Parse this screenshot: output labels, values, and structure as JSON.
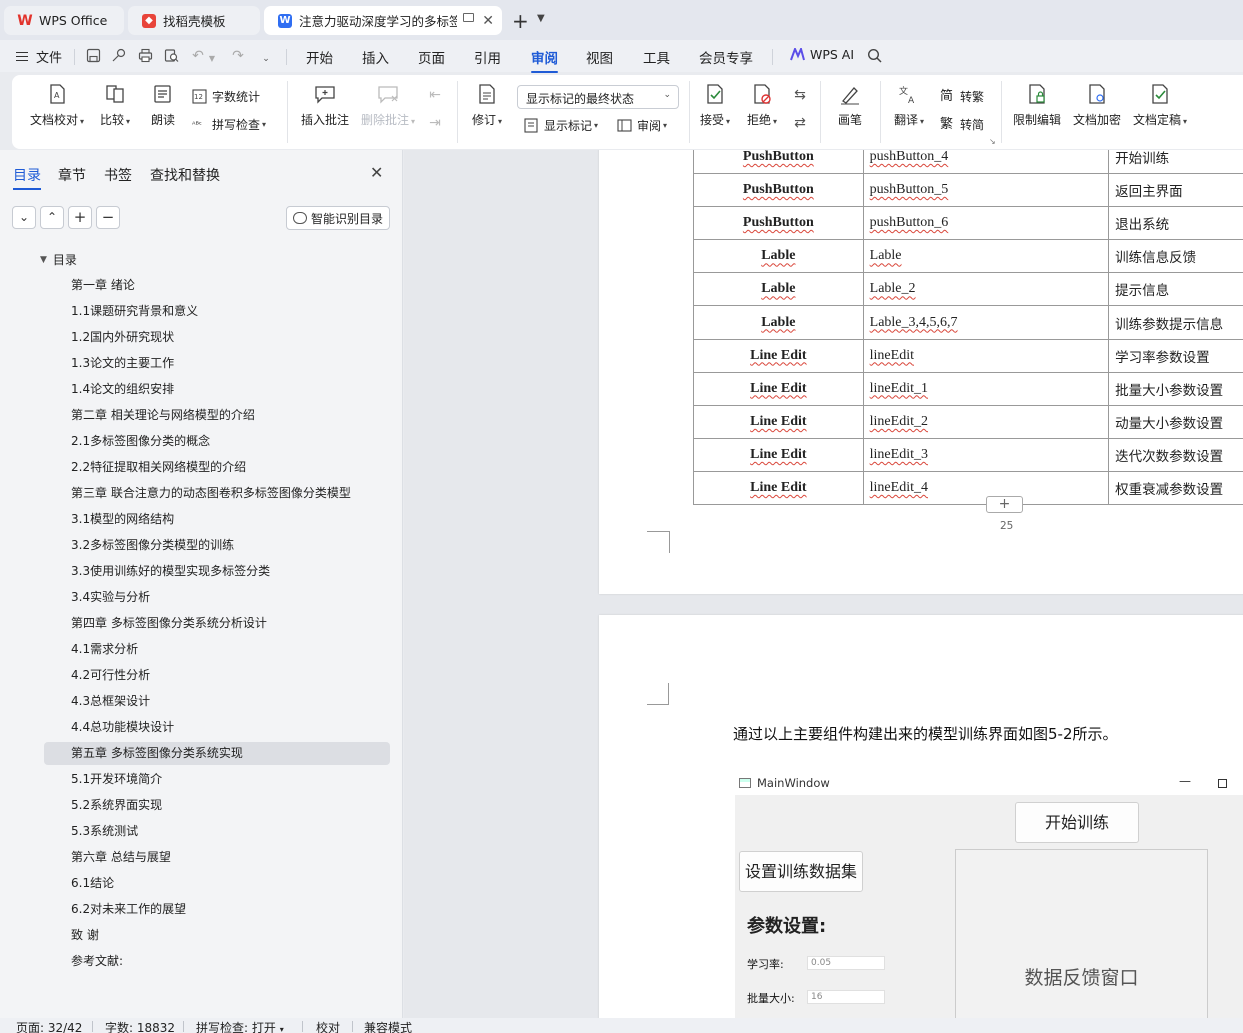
{
  "tabs": [
    {
      "label": "WPS Office"
    },
    {
      "label": "找稻壳模板"
    },
    {
      "label": "注意力驱动深度学习的多标签"
    }
  ],
  "menu": {
    "file": "文件",
    "tabs": [
      "开始",
      "插入",
      "页面",
      "引用",
      "审阅",
      "视图",
      "工具",
      "会员专享"
    ],
    "active_tab": "审阅",
    "wps_ai": "WPS AI"
  },
  "ribbon": {
    "doc_check": "文档校对",
    "compare": "比较",
    "read_aloud": "朗读",
    "word_count": "字数统计",
    "spell_check": "拼写检查",
    "insert_comment": "插入批注",
    "delete_comment": "删除批注",
    "track_changes": "修订",
    "markup_state": "显示标记的最终状态",
    "show_markup": "显示标记",
    "review": "审阅",
    "accept": "接受",
    "reject": "拒绝",
    "pen": "画笔",
    "translate": "翻译",
    "to_traditional": "转繁",
    "to_simplified": "转简",
    "restrict_edit": "限制编辑",
    "doc_encrypt": "文档加密",
    "doc_finalize": "文档定稿"
  },
  "nav_pane": {
    "tabs": [
      "目录",
      "章节",
      "书签",
      "查找和替换"
    ],
    "ai_toc": "智能识别目录",
    "root": "目录",
    "items": [
      "第一章 绪论",
      "1.1课题研究背景和意义",
      "1.2国内外研究现状",
      "1.3论文的主要工作",
      "1.4论文的组织安排",
      "第二章 相关理论与网络模型的介绍",
      "2.1多标签图像分类的概念",
      "2.2特征提取相关网络模型的介绍",
      "第三章 联合注意力的动态图卷积多标签图像分类模型",
      "3.1模型的网络结构",
      "3.2多标签图像分类模型的训练",
      "3.3使用训练好的模型实现多标签分类",
      "3.4实验与分析",
      "第四章 多标签图像分类系统分析设计",
      "4.1需求分析",
      "4.2可行性分析",
      "4.3总框架设计",
      "4.4总功能模块设计",
      "第五章 多标签图像分类系统实现",
      "5.1开发环境简介",
      "5.2系统界面实现",
      "5.3系统测试",
      "第六章 总结与展望",
      "6.1结论",
      "6.2对未来工作的展望",
      "致 谢",
      "参考文献:"
    ],
    "selected_index": 18
  },
  "document": {
    "table_rows": [
      [
        "PushButton",
        "pushButton_4",
        "开始训练"
      ],
      [
        "PushButton",
        "pushButton_5",
        "返回主界面"
      ],
      [
        "PushButton",
        "pushButton_6",
        "退出系统"
      ],
      [
        "Lable",
        "Lable",
        "训练信息反馈"
      ],
      [
        "Lable",
        "Lable_2",
        "提示信息"
      ],
      [
        "Lable",
        "Lable_3,4,5,6,7",
        "训练参数提示信息"
      ],
      [
        "Line Edit",
        "lineEdit",
        "学习率参数设置"
      ],
      [
        "Line Edit",
        "lineEdit_1",
        "批量大小参数设置"
      ],
      [
        "Line Edit",
        "lineEdit_2",
        "动量大小参数设置"
      ],
      [
        "Line Edit",
        "lineEdit_3",
        "迭代次数参数设置"
      ],
      [
        "Line Edit",
        "lineEdit_4",
        "权重衰减参数设置"
      ]
    ],
    "page_number": "25",
    "paragraph": "通过以上主要组件构建出来的模型训练界面如图5-2所示。",
    "figure": {
      "window_title": "MainWindow",
      "start_button": "开始训练",
      "dataset_button": "设置训练数据集",
      "param_title": "参数设置:",
      "feedback_label": "数据反馈窗口",
      "lr_label": "学习率:",
      "lr_value": "0.05",
      "batch_label": "批量大小:",
      "batch_value": "16"
    }
  },
  "status": {
    "page": "页面: 32/42",
    "words": "字数: 18832",
    "spell": "拼写检查: 打开",
    "proof": "校对",
    "compat": "兼容模式"
  }
}
